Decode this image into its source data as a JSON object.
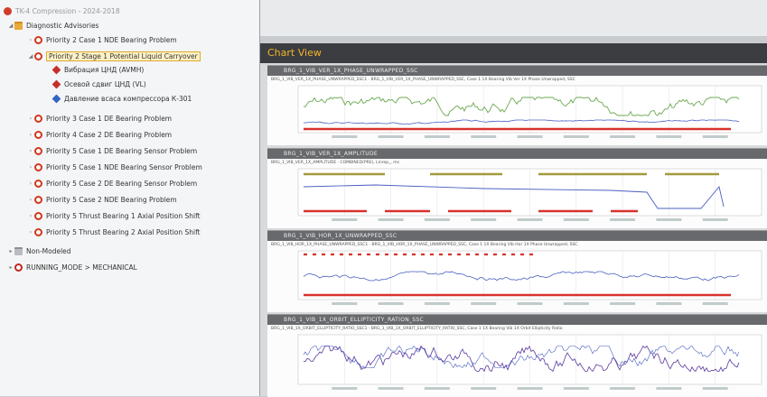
{
  "tree": {
    "root_label": "TK-4 Compression - 2024-2018",
    "advisories_label": "Diagnostic Advisories",
    "items": [
      {
        "label": "Priority 2 Case 1 NDE Bearing Problem",
        "icon": "alert-circle-icon"
      },
      {
        "label": "Priority 2 Stage 1 Potential Liquid Carryover",
        "icon": "alert-circle-icon",
        "selected": true,
        "children": [
          {
            "label": "Вибрация ЦНД (AVMH)",
            "icon": "red-tag-icon"
          },
          {
            "label": "Осевой сдвиг ЦНД (VL)",
            "icon": "red-tag-icon"
          },
          {
            "label": "Давление всаса компрессора К-301",
            "icon": "blue-tag-icon"
          }
        ]
      },
      {
        "label": "Priority 3 Case 1 DE Bearing Problem",
        "icon": "alert-circle-icon"
      },
      {
        "label": "Priority 4 Case 2 DE Bearing Problem",
        "icon": "alert-circle-icon"
      },
      {
        "label": "Priority 5 Case 1 DE Bearing Sensor Problem",
        "icon": "alert-circle-icon"
      },
      {
        "label": "Priority 5 Case 1 NDE Bearing Sensor Problem",
        "icon": "alert-circle-icon"
      },
      {
        "label": "Priority 5 Case 2 DE Bearing Sensor Problem",
        "icon": "alert-circle-icon"
      },
      {
        "label": "Priority 5 Case 2 NDE Bearing Problem",
        "icon": "alert-circle-icon"
      },
      {
        "label": "Priority 5 Thrust Bearing 1 Axial Position Shift",
        "icon": "alert-circle-icon"
      },
      {
        "label": "Priority 5 Thrust Bearing 2 Axial Position Shift",
        "icon": "alert-circle-icon"
      }
    ],
    "non_modeled_label": "Non-Modeled",
    "running_mode_label": "RUNNING_MODE > MECHANICAL"
  },
  "chart_view": {
    "title": "Chart View",
    "panels": [
      {
        "header": "BRG_1_VIB_VER_1X_PHASE_UNWRAPPED_SSC",
        "subtitle": "BRG_1_VIB_VER_1X_PHASE_UNWRAPPED_SSC1 · BRG_1_VIB_VER_1X_PHASE_UNWRAPPED_SSC, Case 1 1X Bearing Vib Ver 1X Phase Unwrapped, SSC"
      },
      {
        "header": "BRG_1_VIB_VER_1X_AMPLITUDE",
        "subtitle": "BRG_1_VIB_VER_1X_AMPLITUDE · COMBINED(PRE), Linrep_, ms"
      },
      {
        "header": "BRG_1_VIB_HOR_1X_UNWRAPPED_SSC",
        "subtitle": "BRG_1_VIB_HOR_1X_PHASE_UNWRAPPED_SSC1 · BRG_1_VIB_HOR_1X_PHASE_UNWRAPPED_SSC, Case 1 1X Bearing Vib Hor 1X Phase Unwrapped, SSC"
      },
      {
        "header": "BRG_1_VIB_1X_ORBIT_ELLIPTICITY_RATION_SSC",
        "subtitle": "BRG_1_VIB_1X_ORBIT_ELLIPTICITY_RATIO_SSC1 · BRG_1_VIB_1X_ORBIT_ELLIPTICITY_RATIO_SSC, Case 1 1X Bearing Vib 1X Orbit Ellipticity Ratio"
      }
    ]
  },
  "colors": {
    "accent": "#f4b42d",
    "green": "#6aa84f",
    "olive": "#a39a3c",
    "blue": "#4a5fc1",
    "red": "#d8322b",
    "purple": "#5b3a9e"
  }
}
